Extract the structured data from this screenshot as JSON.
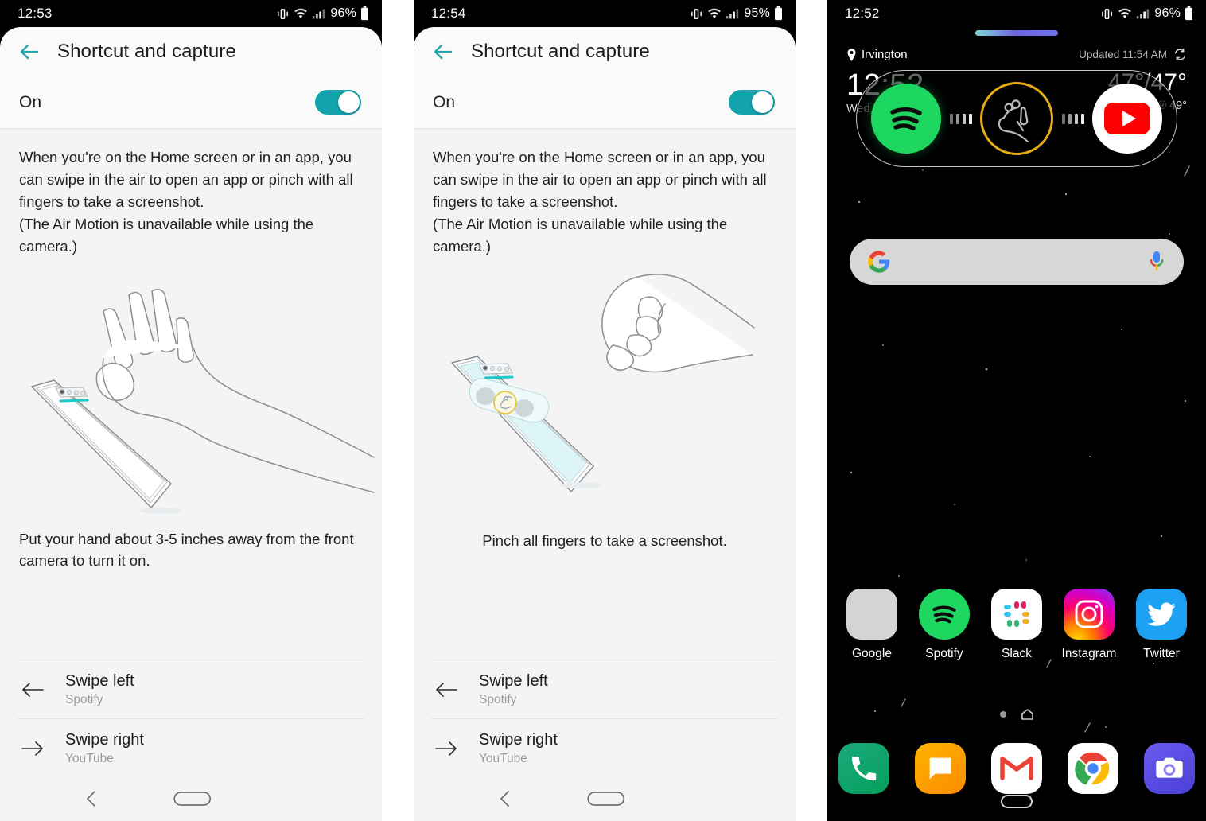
{
  "panels": [
    {
      "id": "settings-air-motion-swipe",
      "status": {
        "time": "12:53",
        "battery": "96%",
        "icons": [
          "vibrate-icon",
          "wifi-icon",
          "signal-icon",
          "battery-icon"
        ]
      },
      "header": {
        "title": "Shortcut and capture",
        "back_icon": "back-arrow-icon"
      },
      "toggle": {
        "label": "On",
        "state": "on",
        "accent": "#13A3AD"
      },
      "description_line1": "When you're on the Home screen or in an app, you can swipe in the air to open an app or pinch with all fingers to take a screenshot.",
      "description_line2": "(The Air Motion is unavailable while using the camera.)",
      "illustration": "open-hand-over-phone",
      "caption": "Put your hand about 3-5 inches away from the front camera to turn it on.",
      "caption_align": "left",
      "shortcuts": [
        {
          "icon": "arrow-left-icon",
          "title": "Swipe left",
          "subtitle": "Spotify"
        },
        {
          "icon": "arrow-right-icon",
          "title": "Swipe right",
          "subtitle": "YouTube"
        }
      ],
      "navbar": {
        "back_icon": "nav-back-icon",
        "home_icon": "nav-home-pill-icon"
      }
    },
    {
      "id": "settings-air-motion-pinch",
      "status": {
        "time": "12:54",
        "battery": "95%",
        "icons": [
          "vibrate-icon",
          "wifi-icon",
          "signal-icon",
          "battery-icon"
        ]
      },
      "header": {
        "title": "Shortcut and capture",
        "back_icon": "back-arrow-icon"
      },
      "toggle": {
        "label": "On",
        "state": "on",
        "accent": "#13A3AD"
      },
      "description_line1": "When you're on the Home screen or in an app, you can swipe in the air to open an app or pinch with all fingers to take a screenshot.",
      "description_line2": "(The Air Motion is unavailable while using the camera.)",
      "illustration": "pinching-fist-over-phone",
      "caption": "Pinch all fingers to take a screenshot.",
      "caption_align": "center",
      "shortcuts": [
        {
          "icon": "arrow-left-icon",
          "title": "Swipe left",
          "subtitle": "Spotify"
        },
        {
          "icon": "arrow-right-icon",
          "title": "Swipe right",
          "subtitle": "YouTube"
        }
      ],
      "navbar": {
        "back_icon": "nav-back-icon",
        "home_icon": "nav-home-pill-icon"
      }
    }
  ],
  "home": {
    "status": {
      "time": "12:52",
      "battery": "96%"
    },
    "weather": {
      "location": "Irvington",
      "location_icon": "location-pin-icon",
      "updated": "Updated 11:54 AM",
      "refresh_icon": "refresh-icon",
      "clock": "12:52",
      "date": "Wed, April",
      "temps": "47°/47°",
      "feels": "Feel® 49°"
    },
    "air_motion_overlay": {
      "left_app": "Spotify",
      "left_icon": "spotify-icon",
      "center_icon": "pinch-hand-gesture-icon",
      "center_ring_color": "#e8ad16",
      "right_app": "YouTube",
      "right_icon": "youtube-icon"
    },
    "search": {
      "google_icon": "google-g-icon",
      "mic_icon": "microphone-icon",
      "placeholder": ""
    },
    "apps_row": [
      {
        "label": "Google",
        "icon": "google-folder-icon"
      },
      {
        "label": "Spotify",
        "icon": "spotify-icon"
      },
      {
        "label": "Slack",
        "icon": "slack-icon"
      },
      {
        "label": "Instagram",
        "icon": "instagram-icon"
      },
      {
        "label": "Twitter",
        "icon": "twitter-icon"
      }
    ],
    "dock": [
      {
        "label": "Phone",
        "icon": "phone-icon"
      },
      {
        "label": "Messages",
        "icon": "messages-icon"
      },
      {
        "label": "Gmail",
        "icon": "gmail-icon"
      },
      {
        "label": "Chrome",
        "icon": "chrome-icon"
      },
      {
        "label": "Camera",
        "icon": "camera-icon"
      }
    ],
    "page_indicator": {
      "dot_icon": "page-dot-icon",
      "home_page_icon": "home-page-icon"
    },
    "home_pill_icon": "nav-home-pill-icon"
  }
}
